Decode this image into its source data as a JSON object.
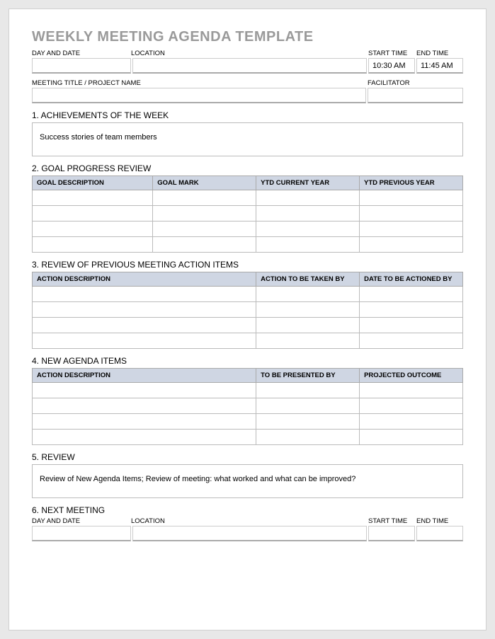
{
  "title": "WEEKLY MEETING AGENDA TEMPLATE",
  "header": {
    "labels": {
      "day_date": "DAY AND DATE",
      "location": "LOCATION",
      "start_time": "START TIME",
      "end_time": "END TIME",
      "meeting_title": "MEETING TITLE / PROJECT NAME",
      "facilitator": "FACILITATOR"
    },
    "values": {
      "day_date": "",
      "location": "",
      "start_time": "10:30 AM",
      "end_time": "11:45 AM",
      "meeting_title": "",
      "facilitator": ""
    }
  },
  "sections": {
    "achievements": {
      "heading": "1. ACHIEVEMENTS OF THE WEEK",
      "body": "Success stories of team members"
    },
    "goal_progress": {
      "heading": "2. GOAL PROGRESS REVIEW",
      "columns": [
        "GOAL DESCRIPTION",
        "GOAL MARK",
        "YTD CURRENT YEAR",
        "YTD PREVIOUS YEAR"
      ],
      "rows": [
        [
          "",
          "",
          "",
          ""
        ],
        [
          "",
          "",
          "",
          ""
        ],
        [
          "",
          "",
          "",
          ""
        ],
        [
          "",
          "",
          "",
          ""
        ]
      ]
    },
    "previous_actions": {
      "heading": "3. REVIEW OF PREVIOUS MEETING ACTION ITEMS",
      "columns": [
        "ACTION DESCRIPTION",
        "ACTION TO BE TAKEN BY",
        "DATE TO BE ACTIONED BY"
      ],
      "rows": [
        [
          "",
          "",
          ""
        ],
        [
          "",
          "",
          ""
        ],
        [
          "",
          "",
          ""
        ],
        [
          "",
          "",
          ""
        ]
      ]
    },
    "new_agenda": {
      "heading": "4. NEW AGENDA ITEMS",
      "columns": [
        "ACTION DESCRIPTION",
        "TO BE PRESENTED BY",
        "PROJECTED OUTCOME"
      ],
      "rows": [
        [
          "",
          "",
          ""
        ],
        [
          "",
          "",
          ""
        ],
        [
          "",
          "",
          ""
        ],
        [
          "",
          "",
          ""
        ]
      ]
    },
    "review": {
      "heading": "5. REVIEW",
      "body": "Review of New Agenda Items; Review of meeting: what worked and what can be improved?"
    },
    "next_meeting": {
      "heading": "6. NEXT MEETING",
      "labels": {
        "day_date": "DAY AND DATE",
        "location": "LOCATION",
        "start_time": "START TIME",
        "end_time": "END TIME"
      },
      "values": {
        "day_date": "",
        "location": "",
        "start_time": "",
        "end_time": ""
      }
    }
  }
}
